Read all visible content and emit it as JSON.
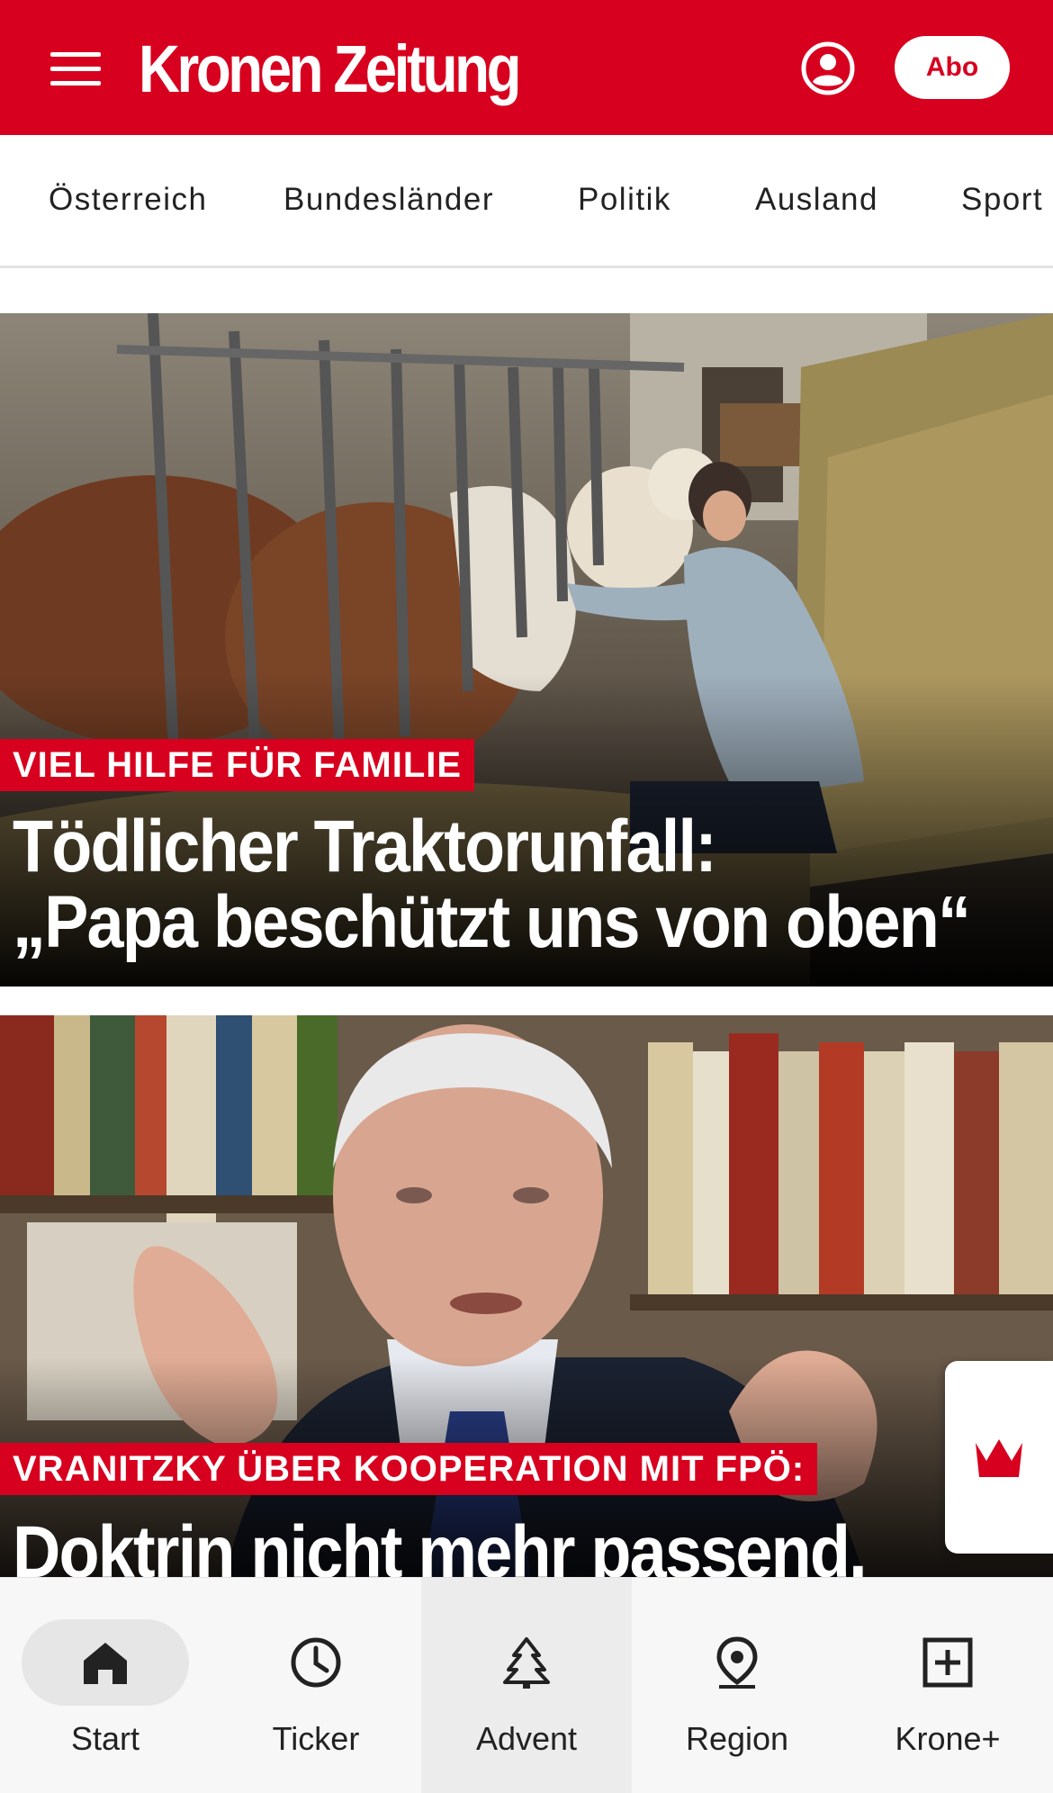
{
  "header": {
    "logo_text": "Kronen Zeitung",
    "abo_label": "Abo",
    "brand_color": "#d7001e"
  },
  "nav": {
    "items": [
      "Österreich",
      "Bundesländer",
      "Politik",
      "Ausland",
      "Sport"
    ]
  },
  "articles": [
    {
      "kicker": "VIEL HILFE FÜR FAMILIE",
      "headline_line1": "Tödlicher Traktorunfall:",
      "headline_line2": "„Papa beschützt uns von oben“"
    },
    {
      "kicker": "VRANITZKY ÜBER KOOPERATION MIT FPÖ:",
      "headline_line1": "Doktrin nicht mehr passend."
    }
  ],
  "bottom_nav": {
    "items": [
      {
        "label": "Start",
        "icon": "home-icon",
        "active": true
      },
      {
        "label": "Ticker",
        "icon": "clock-icon",
        "active": false
      },
      {
        "label": "Advent",
        "icon": "tree-icon",
        "active": false
      },
      {
        "label": "Region",
        "icon": "location-pin-icon",
        "active": false
      },
      {
        "label": "Krone+",
        "icon": "plus-box-icon",
        "active": false
      }
    ]
  }
}
